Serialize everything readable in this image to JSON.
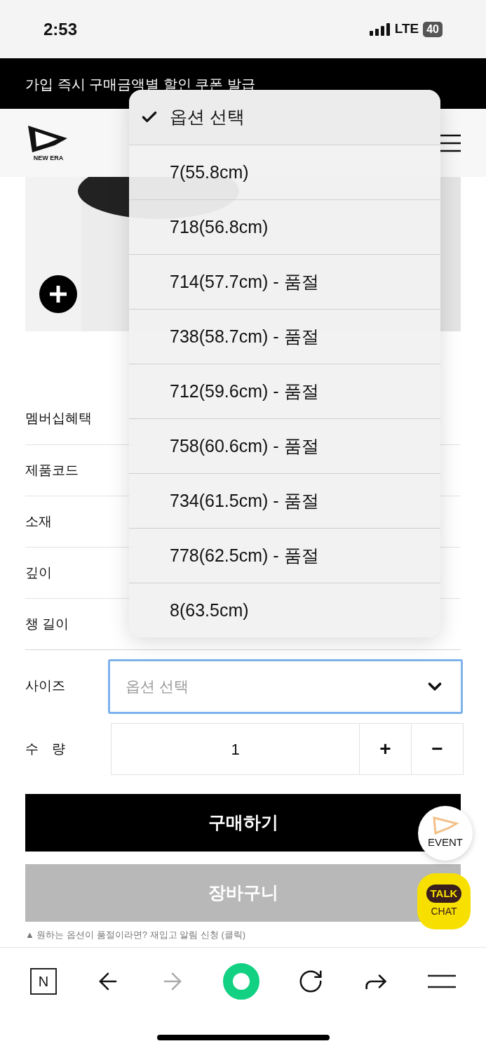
{
  "status_bar": {
    "time": "2:53",
    "network": "LTE",
    "battery": "40"
  },
  "banner": {
    "text": "가입 즉시 구매금액별 할인 쿠폰 발급"
  },
  "header": {
    "logo_text": "NEW ERA"
  },
  "product_info": [
    {
      "label": "멤버십혜택"
    },
    {
      "label": "제품코드"
    },
    {
      "label": "소재"
    },
    {
      "label": "깊이"
    },
    {
      "label": "챙 길이"
    }
  ],
  "size": {
    "label": "사이즈",
    "placeholder": "옵션 선택"
  },
  "quantity": {
    "label": "수　량",
    "value": "1",
    "plus": "+",
    "minus": "−"
  },
  "buttons": [
    {
      "label": "구매하기",
      "kind": "primary"
    },
    {
      "label": "장바구니",
      "kind": "secondary"
    }
  ],
  "restock_note": "▲ 원하는 옵션이 품절이라면? 재입고 알림 신청 (클릭)",
  "floating": [
    {
      "label": "EVENT",
      "kind": "event"
    },
    {
      "label": "CHAT",
      "badge": "TALK",
      "kind": "talk"
    }
  ],
  "dropdown": {
    "options": [
      {
        "label": "옵션 선택",
        "selected": true
      },
      {
        "label": "7(55.8cm)",
        "selected": false
      },
      {
        "label": "718(56.8cm)",
        "selected": false
      },
      {
        "label": "714(57.7cm) - 품절",
        "selected": false
      },
      {
        "label": "738(58.7cm) - 품절",
        "selected": false
      },
      {
        "label": "712(59.6cm) - 품절",
        "selected": false
      },
      {
        "label": "758(60.6cm) - 품절",
        "selected": false
      },
      {
        "label": "734(61.5cm) - 품절",
        "selected": false
      },
      {
        "label": "778(62.5cm) - 품절",
        "selected": false
      },
      {
        "label": "8(63.5cm)",
        "selected": false
      }
    ]
  },
  "toolbar": {
    "home_letter": "N",
    "forward_disabled": true
  }
}
